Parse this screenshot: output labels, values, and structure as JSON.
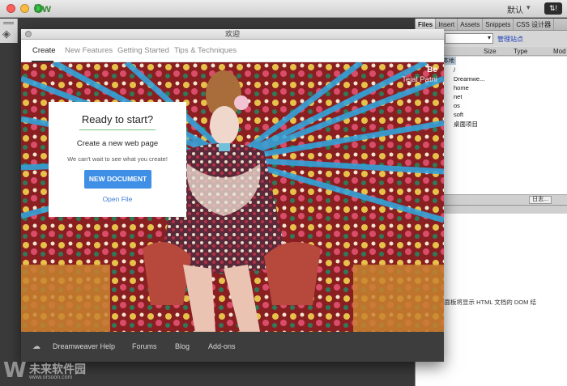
{
  "app": {
    "logo": "Dw",
    "workspace": "默认",
    "sync": "⇅!"
  },
  "panels": {
    "tabs": [
      {
        "label": "Files"
      },
      {
        "label": "Insert"
      },
      {
        "label": "Assets"
      },
      {
        "label": "Snippets"
      },
      {
        "label": "CSS 设计器"
      }
    ],
    "manage_sites": "管理站点",
    "columns": [
      "Size",
      "Type",
      "Mod"
    ],
    "local_label": "本地",
    "files": [
      "/",
      "Dreamwe...",
      "home",
      "net",
      "os",
      "soft",
      "桌面项目"
    ],
    "log_button": "日志...",
    "dom_message": "此面板将显示 HTML 文档的 DOM 结"
  },
  "welcome": {
    "title": "欢迎",
    "tabs": [
      {
        "label": "Create"
      },
      {
        "label": "New Features"
      },
      {
        "label": "Getting Started"
      },
      {
        "label": "Tips & Techniques"
      }
    ],
    "credit_brand": "Be",
    "credit_name": "Tejal Patni",
    "card": {
      "title": "Ready to start?",
      "subtitle": "Create a new web page",
      "description": "We can't wait to see what you create!",
      "button": "NEW DOCUMENT",
      "open_file": "Open File"
    },
    "footer_links": [
      "Dreamweaver Help",
      "Forums",
      "Blog",
      "Add-ons"
    ]
  },
  "watermark": {
    "logo": "W",
    "name": "未来软件园",
    "url": "www.orsoon.com"
  }
}
